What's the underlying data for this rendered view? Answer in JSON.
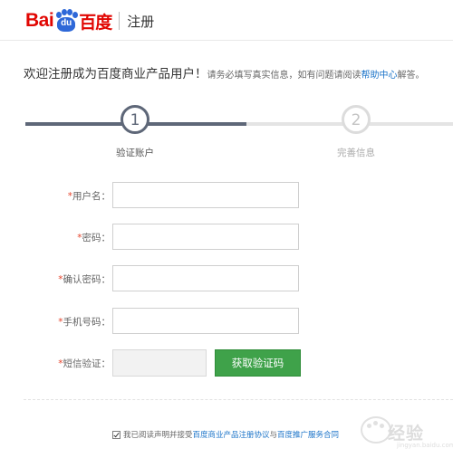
{
  "header": {
    "logo_bai": "Bai",
    "logo_du": "du",
    "logo_cn": "百度",
    "section": "注册"
  },
  "welcome": {
    "main": "欢迎注册成为百度商业产品用户！",
    "sub": "请务必填写真实信息，如有问题请阅读",
    "help_link": "帮助中心",
    "tail": "解答。"
  },
  "steps": [
    {
      "number": "1",
      "label": "验证账户",
      "active": true
    },
    {
      "number": "2",
      "label": "完善信息",
      "active": false
    }
  ],
  "form": {
    "required_mark": "*",
    "username_label": "用户名：",
    "password_label": "密码：",
    "confirm_password_label": "确认密码：",
    "phone_label": "手机号码：",
    "sms_label": "短信验证：",
    "username_value": "",
    "password_value": "",
    "confirm_password_value": "",
    "phone_value": "",
    "sms_value": "",
    "get_code_button": "获取验证码"
  },
  "agreement": {
    "checked": true,
    "prefix": "我已阅读声明并接受",
    "link1": "百度商业产品注册协议",
    "middle": "与",
    "link2": "百度推广服务合同"
  },
  "watermark": {
    "text": "经验",
    "en": "jingyan.baidu.com"
  },
  "colors": {
    "brand_red": "#e10602",
    "brand_blue": "#2e68d8",
    "step_active": "#5e6778",
    "button_green": "#3fa24a",
    "link_blue": "#1a73c8"
  }
}
